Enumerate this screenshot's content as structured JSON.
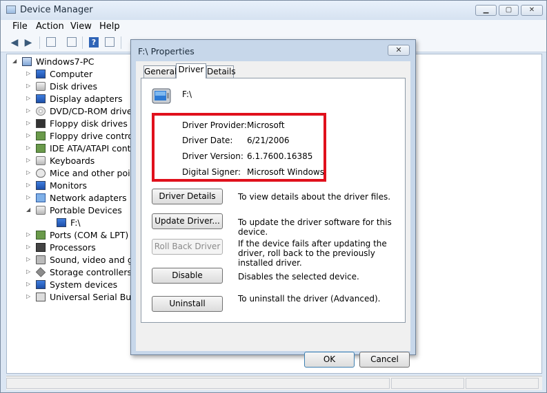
{
  "window": {
    "title": "Device Manager"
  },
  "menu": [
    "File",
    "Action",
    "View",
    "Help"
  ],
  "tree": {
    "root": "Windows7-PC",
    "items": [
      {
        "label": "Computer",
        "icon": "computer-icon"
      },
      {
        "label": "Disk drives",
        "icon": "disk-drive-icon"
      },
      {
        "label": "Display adapters",
        "icon": "display-adapter-icon"
      },
      {
        "label": "DVD/CD-ROM drives",
        "icon": "dvd-drive-icon"
      },
      {
        "label": "Floppy disk drives",
        "icon": "floppy-disk-icon"
      },
      {
        "label": "Floppy drive controllers",
        "icon": "floppy-controller-icon"
      },
      {
        "label": "IDE ATA/ATAPI controllers",
        "icon": "ide-controller-icon"
      },
      {
        "label": "Keyboards",
        "icon": "keyboard-icon"
      },
      {
        "label": "Mice and other pointing devices",
        "icon": "mouse-icon"
      },
      {
        "label": "Monitors",
        "icon": "monitor-icon"
      },
      {
        "label": "Network adapters",
        "icon": "network-adapter-icon"
      },
      {
        "label": "Portable Devices",
        "icon": "portable-device-icon"
      },
      {
        "label": "F:\\",
        "icon": "portable-drive-icon"
      },
      {
        "label": "Ports (COM & LPT)",
        "icon": "port-icon"
      },
      {
        "label": "Processors",
        "icon": "processor-icon"
      },
      {
        "label": "Sound, video and game controllers",
        "icon": "sound-icon"
      },
      {
        "label": "Storage controllers",
        "icon": "storage-controller-icon"
      },
      {
        "label": "System devices",
        "icon": "system-device-icon"
      },
      {
        "label": "Universal Serial Bus controllers",
        "icon": "usb-icon"
      }
    ]
  },
  "dialog": {
    "title": "F:\\ Properties",
    "tabs": [
      "General",
      "Driver",
      "Details"
    ],
    "active_tab": "Driver",
    "device_name": "F:\\",
    "info": {
      "provider_label": "Driver Provider:",
      "provider_value": "Microsoft",
      "date_label": "Driver Date:",
      "date_value": "6/21/2006",
      "version_label": "Driver Version:",
      "version_value": "6.1.7600.16385",
      "signer_label": "Digital Signer:",
      "signer_value": "Microsoft Windows"
    },
    "actions": {
      "details_label": "Driver Details",
      "details_desc": "To view details about the driver files.",
      "update_label": "Update Driver...",
      "update_desc": "To update the driver software for this device.",
      "rollback_label": "Roll Back Driver",
      "rollback_desc": "If the device fails after updating the driver, roll back to the previously installed driver.",
      "disable_label": "Disable",
      "disable_desc": "Disables the selected device.",
      "uninstall_label": "Uninstall",
      "uninstall_desc": "To uninstall the driver (Advanced)."
    },
    "ok_label": "OK",
    "cancel_label": "Cancel"
  },
  "colors": {
    "highlight_box": "#e0101c",
    "dialog_frame": "#c7d7ea"
  }
}
